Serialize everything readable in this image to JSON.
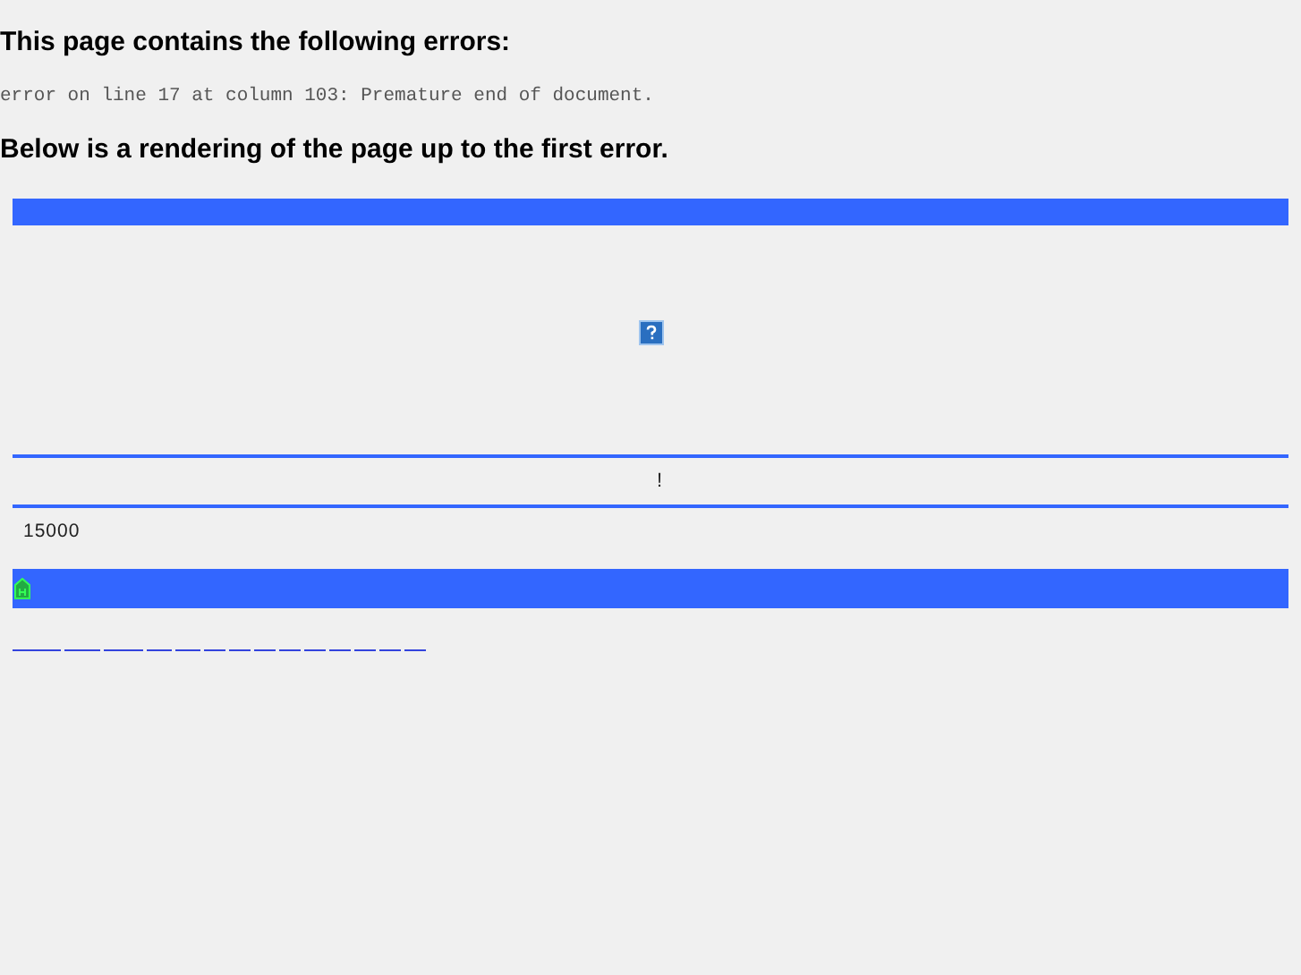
{
  "error_heading": "This page contains the following errors:",
  "error_message": "error on line 17 at column 103: Premature end of document.",
  "rendering_heading": "Below is a rendering of the page up to the first error.",
  "notice": "!",
  "value": "15000"
}
